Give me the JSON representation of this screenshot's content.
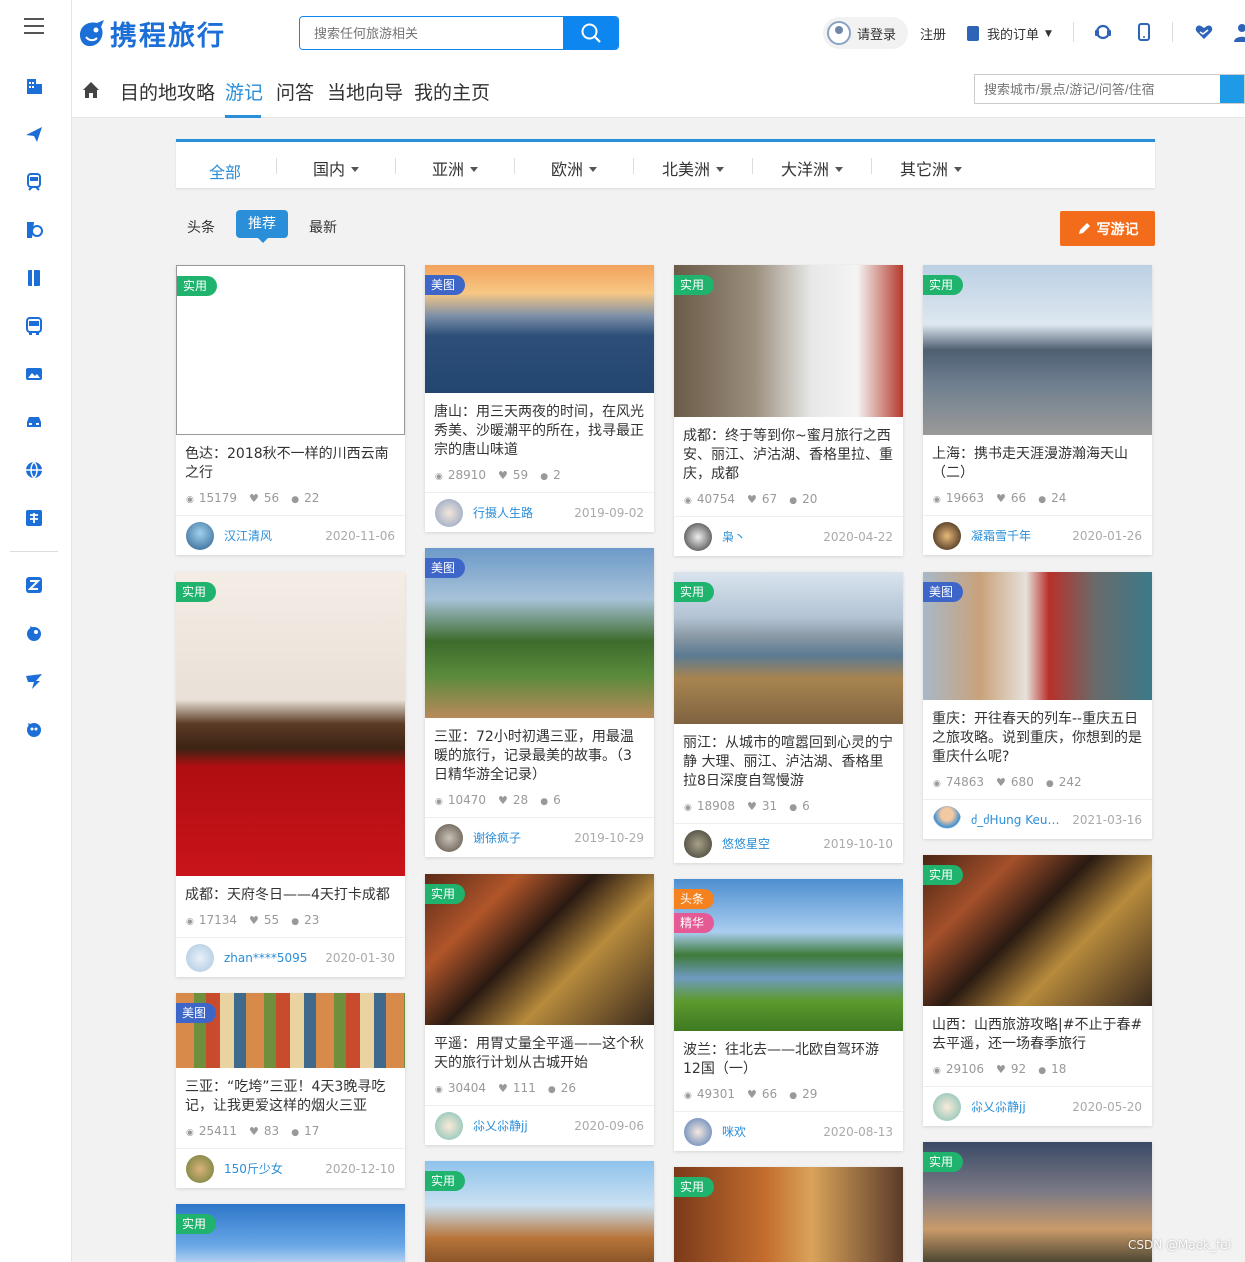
{
  "brand": {
    "name": "携程旅行",
    "color": "#1b6fd6"
  },
  "header": {
    "search_placeholder": "搜索任何旅游相关",
    "login": "请登录",
    "register": "注册",
    "orders": "我的订单"
  },
  "subnav": {
    "items": [
      "目的地攻略",
      "游记",
      "问答",
      "当地向导",
      "我的主页"
    ],
    "active": "游记",
    "search_placeholder": "搜索城市/景点/游记/问答/住宿"
  },
  "regions": [
    "全部",
    "国内",
    "亚洲",
    "欧洲",
    "北美洲",
    "大洋洲",
    "其它洲"
  ],
  "sort_tabs": [
    "头条",
    "推荐",
    "最新"
  ],
  "write_button": "写游记",
  "cards": [
    {
      "tag": "实用",
      "title": "色达：2018秋不一样的川西云南之行",
      "views": "15179",
      "likes": "56",
      "comments": "22",
      "user": "汉江清风",
      "date": "2020-11-06"
    },
    {
      "tag": "美图",
      "title": "唐山：用三天两夜的时间，在风光秀美、沙暖潮平的所在，找寻最正宗的唐山味道",
      "views": "28910",
      "likes": "59",
      "comments": "2",
      "user": "行摄人生路",
      "date": "2019-09-02"
    },
    {
      "tag": "实用",
      "title": "成都：终于等到你~蜜月旅行之西安、丽江、泸沽湖、香格里拉、重庆，成都",
      "views": "40754",
      "likes": "67",
      "comments": "20",
      "user": "枭丶",
      "date": "2020-04-22"
    },
    {
      "tag": "实用",
      "title": "上海：携书走天涯漫游瀚海天山（二）",
      "views": "19663",
      "likes": "66",
      "comments": "24",
      "user": "凝霜雪千年",
      "date": "2020-01-26"
    },
    {
      "tag": "实用",
      "title": "成都：天府冬日——4天打卡成都",
      "views": "17134",
      "likes": "55",
      "comments": "23",
      "user": "zhan****5095",
      "date": "2020-01-30"
    },
    {
      "tag": "美图",
      "title": "三亚：72小时初遇三亚，用最温暖的旅行，记录最美的故事。（3日精华游全记录）",
      "views": "10470",
      "likes": "28",
      "comments": "6",
      "user": "谢徐疯子",
      "date": "2019-10-29"
    },
    {
      "tag": "实用",
      "title": "丽江：从城市的喧嚣回到心灵的宁静 大理、丽江、泸沽湖、香格里拉8日深度自驾慢游",
      "views": "18908",
      "likes": "31",
      "comments": "6",
      "user": "悠悠星空",
      "date": "2019-10-10"
    },
    {
      "tag": "美图",
      "title": "重庆：开往春天的列车--重庆五日之旅攻略。说到重庆，你想到的是重庆什么呢?",
      "views": "74863",
      "likes": "680",
      "comments": "242",
      "user": "ძ_ძHung Keun…",
      "date": "2021-03-16"
    },
    {
      "tag": "美图",
      "title": "三亚：“吃垮”三亚！4天3晚寻吃记，让我更爱这样的烟火三亚",
      "views": "25411",
      "likes": "83",
      "comments": "17",
      "user": "150斤少女",
      "date": "2020-12-10"
    },
    {
      "tag": "实用",
      "title": "平遥：用胃丈量全平遥——这个秋天的旅行计划从古城开始",
      "views": "30404",
      "likes": "111",
      "comments": "26",
      "user": "尛乂尛静jj",
      "date": "2020-09-06"
    },
    {
      "tag": "头条",
      "tag2": "精华",
      "title": "波兰：往北去——北欧自驾环游12国（一）",
      "views": "49301",
      "likes": "66",
      "comments": "29",
      "user": "咪欢",
      "date": "2020-08-13"
    },
    {
      "tag": "实用",
      "title": "山西：山西旅游攻略|#不止于春#去平遥，还一场春季旅行",
      "views": "29106",
      "likes": "92",
      "comments": "18",
      "user": "尛乂尛静jj",
      "date": "2020-05-20"
    },
    {
      "tag": "实用"
    },
    {
      "tag": "实用"
    },
    {
      "tag": "实用"
    },
    {
      "tag": "实用"
    }
  ],
  "watermark": "CSDN @Maek_fei"
}
